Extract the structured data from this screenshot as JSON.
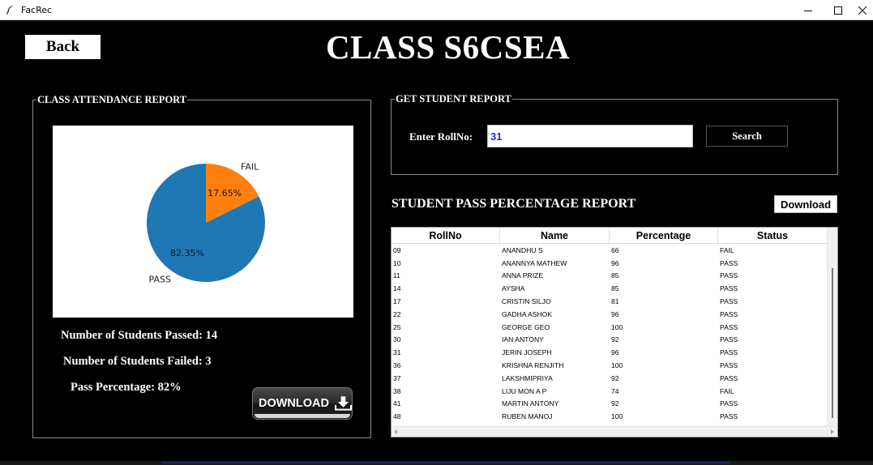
{
  "window": {
    "title": "FacRec",
    "app_icon": "feather-icon",
    "controls": [
      "minimize-icon",
      "maximize-icon",
      "close-icon"
    ]
  },
  "header": {
    "back_label": "Back",
    "title": "CLASS S6CSEA"
  },
  "attendance": {
    "legend": "CLASS ATTENDANCE REPORT",
    "passed_label": "Number of Students Passed: 14",
    "failed_label": "Number of Students Failed: 3",
    "percentage_label": "Pass Percentage: 82%",
    "download_label": "DOWNLOAD",
    "download_icon": "download-icon"
  },
  "chart_data": {
    "type": "pie",
    "labels": [
      "FAIL",
      "PASS"
    ],
    "values": [
      17.65,
      82.35
    ],
    "value_labels": [
      "17.65%",
      "82.35%"
    ],
    "colors": [
      "#ff7f0e",
      "#1f77b4"
    ]
  },
  "student_report": {
    "legend": "GET STUDENT REPORT",
    "roll_label": "Enter RollNo:",
    "roll_value": "31",
    "search_label": "Search"
  },
  "pass_report": {
    "title": "STUDENT PASS PERCENTAGE REPORT",
    "download_label": "Download",
    "columns": [
      "RollNo",
      "Name",
      "Percentage",
      "Status"
    ],
    "rows": [
      [
        "09",
        "ANANDHU S",
        "66",
        "FAIL"
      ],
      [
        "10",
        "ANANNYA MATHEW",
        "96",
        "PASS"
      ],
      [
        "11",
        "ANNA PRIZE",
        "85",
        "PASS"
      ],
      [
        "14",
        "AYSHA",
        "85",
        "PASS"
      ],
      [
        "17",
        "CRISTIN SILJO",
        "81",
        "PASS"
      ],
      [
        "22",
        "GADHA ASHOK",
        "96",
        "PASS"
      ],
      [
        "25",
        "GEORGE GEO",
        "100",
        "PASS"
      ],
      [
        "30",
        "IAN ANTONY",
        "92",
        "PASS"
      ],
      [
        "31",
        "JERIN JOSEPH",
        "96",
        "PASS"
      ],
      [
        "36",
        "KRISHNA RENJITH",
        "100",
        "PASS"
      ],
      [
        "37",
        "LAKSHMIPRIYA",
        "92",
        "PASS"
      ],
      [
        "38",
        "LIJU MON A P",
        "74",
        "FAIL"
      ],
      [
        "41",
        "MARTIN ANTONY",
        "92",
        "PASS"
      ],
      [
        "48",
        "RUBEN MANOJ",
        "100",
        "PASS"
      ]
    ]
  }
}
